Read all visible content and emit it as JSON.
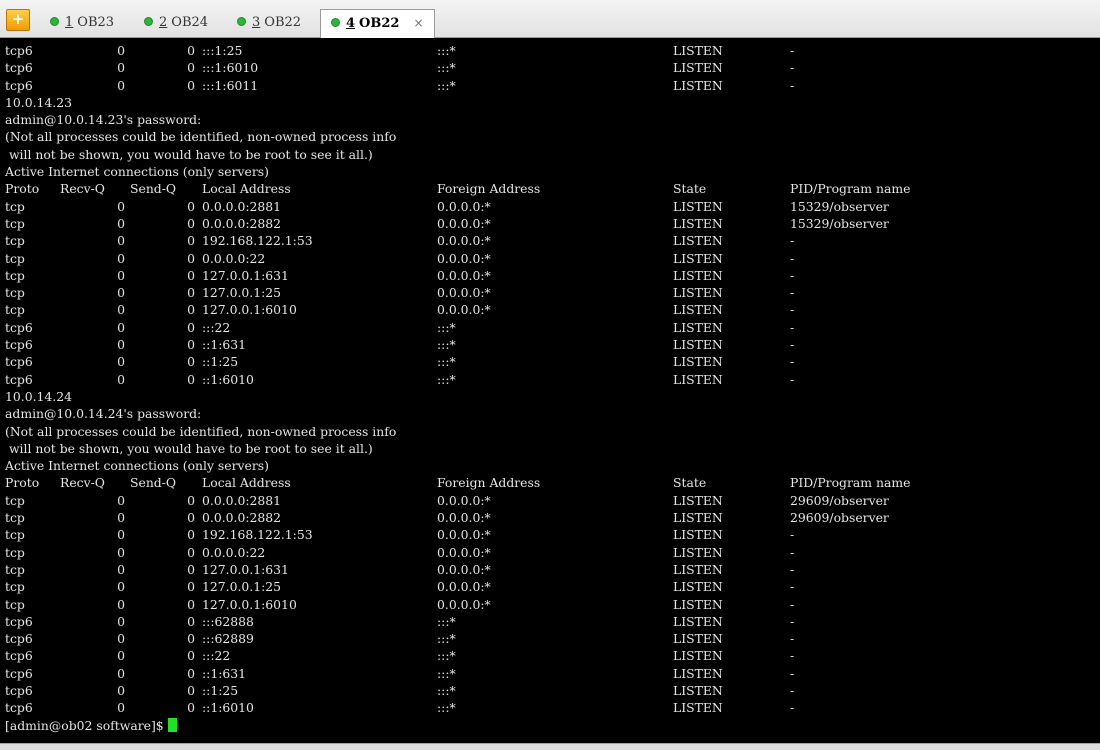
{
  "tabs": [
    {
      "number": "1",
      "title": "OB23",
      "active": false
    },
    {
      "number": "2",
      "title": "OB24",
      "active": false
    },
    {
      "number": "3",
      "title": "OB22",
      "active": false
    },
    {
      "number": "4",
      "title": "OB22",
      "active": true
    }
  ],
  "new_tab_label": "+",
  "close_label": "×",
  "terminal": {
    "lines": [
      {
        "cols": [
          "tcp6",
          "0",
          "0",
          ":::1:25",
          ":::*",
          "LISTEN",
          "-"
        ]
      },
      {
        "cols": [
          "tcp6",
          "0",
          "0",
          ":::1:6010",
          ":::*",
          "LISTEN",
          "-"
        ]
      },
      {
        "cols": [
          "tcp6",
          "0",
          "0",
          ":::1:6011",
          ":::*",
          "LISTEN",
          "-"
        ]
      },
      {
        "text": "10.0.14.23"
      },
      {
        "text": "admin@10.0.14.23's password:"
      },
      {
        "text": "(Not all processes could be identified, non-owned process info"
      },
      {
        "text": " will not be shown, you would have to be root to see it all.)"
      },
      {
        "text": "Active Internet connections (only servers)"
      },
      {
        "cols": [
          "Proto",
          "Recv-Q",
          "Send-Q",
          "Local Address",
          "Foreign Address",
          "State",
          "PID/Program name"
        ],
        "header": true
      },
      {
        "cols": [
          "tcp",
          "0",
          "0",
          "0.0.0.0:2881",
          "0.0.0.0:*",
          "LISTEN",
          "15329/observer"
        ]
      },
      {
        "cols": [
          "tcp",
          "0",
          "0",
          "0.0.0.0:2882",
          "0.0.0.0:*",
          "LISTEN",
          "15329/observer"
        ]
      },
      {
        "cols": [
          "tcp",
          "0",
          "0",
          "192.168.122.1:53",
          "0.0.0.0:*",
          "LISTEN",
          "-"
        ]
      },
      {
        "cols": [
          "tcp",
          "0",
          "0",
          "0.0.0.0:22",
          "0.0.0.0:*",
          "LISTEN",
          "-"
        ]
      },
      {
        "cols": [
          "tcp",
          "0",
          "0",
          "127.0.0.1:631",
          "0.0.0.0:*",
          "LISTEN",
          "-"
        ]
      },
      {
        "cols": [
          "tcp",
          "0",
          "0",
          "127.0.0.1:25",
          "0.0.0.0:*",
          "LISTEN",
          "-"
        ]
      },
      {
        "cols": [
          "tcp",
          "0",
          "0",
          "127.0.0.1:6010",
          "0.0.0.0:*",
          "LISTEN",
          "-"
        ]
      },
      {
        "cols": [
          "tcp6",
          "0",
          "0",
          ":::22",
          ":::*",
          "LISTEN",
          "-"
        ]
      },
      {
        "cols": [
          "tcp6",
          "0",
          "0",
          "::1:631",
          ":::*",
          "LISTEN",
          "-"
        ]
      },
      {
        "cols": [
          "tcp6",
          "0",
          "0",
          "::1:25",
          ":::*",
          "LISTEN",
          "-"
        ]
      },
      {
        "cols": [
          "tcp6",
          "0",
          "0",
          "::1:6010",
          ":::*",
          "LISTEN",
          "-"
        ]
      },
      {
        "text": "10.0.14.24"
      },
      {
        "text": "admin@10.0.14.24's password:"
      },
      {
        "text": "(Not all processes could be identified, non-owned process info"
      },
      {
        "text": " will not be shown, you would have to be root to see it all.)"
      },
      {
        "text": "Active Internet connections (only servers)"
      },
      {
        "cols": [
          "Proto",
          "Recv-Q",
          "Send-Q",
          "Local Address",
          "Foreign Address",
          "State",
          "PID/Program name"
        ],
        "header": true
      },
      {
        "cols": [
          "tcp",
          "0",
          "0",
          "0.0.0.0:2881",
          "0.0.0.0:*",
          "LISTEN",
          "29609/observer"
        ]
      },
      {
        "cols": [
          "tcp",
          "0",
          "0",
          "0.0.0.0:2882",
          "0.0.0.0:*",
          "LISTEN",
          "29609/observer"
        ]
      },
      {
        "cols": [
          "tcp",
          "0",
          "0",
          "192.168.122.1:53",
          "0.0.0.0:*",
          "LISTEN",
          "-"
        ]
      },
      {
        "cols": [
          "tcp",
          "0",
          "0",
          "0.0.0.0:22",
          "0.0.0.0:*",
          "LISTEN",
          "-"
        ]
      },
      {
        "cols": [
          "tcp",
          "0",
          "0",
          "127.0.0.1:631",
          "0.0.0.0:*",
          "LISTEN",
          "-"
        ]
      },
      {
        "cols": [
          "tcp",
          "0",
          "0",
          "127.0.0.1:25",
          "0.0.0.0:*",
          "LISTEN",
          "-"
        ]
      },
      {
        "cols": [
          "tcp",
          "0",
          "0",
          "127.0.0.1:6010",
          "0.0.0.0:*",
          "LISTEN",
          "-"
        ]
      },
      {
        "cols": [
          "tcp6",
          "0",
          "0",
          ":::62888",
          ":::*",
          "LISTEN",
          "-"
        ]
      },
      {
        "cols": [
          "tcp6",
          "0",
          "0",
          ":::62889",
          ":::*",
          "LISTEN",
          "-"
        ]
      },
      {
        "cols": [
          "tcp6",
          "0",
          "0",
          ":::22",
          ":::*",
          "LISTEN",
          "-"
        ]
      },
      {
        "cols": [
          "tcp6",
          "0",
          "0",
          "::1:631",
          ":::*",
          "LISTEN",
          "-"
        ]
      },
      {
        "cols": [
          "tcp6",
          "0",
          "0",
          "::1:25",
          ":::*",
          "LISTEN",
          "-"
        ]
      },
      {
        "cols": [
          "tcp6",
          "0",
          "0",
          "::1:6010",
          ":::*",
          "LISTEN",
          "-"
        ]
      }
    ],
    "prompt": "[admin@ob02 software]$"
  },
  "colors": {
    "background": "#000000",
    "text": "#e6e6e6",
    "cursor": "#22e022",
    "tab_dot": "#2fb43a",
    "new_tab_button": "#f29a00"
  },
  "icons": {
    "new_tab": "plus-icon",
    "tab_status": "green-dot-icon",
    "close": "close-icon"
  }
}
